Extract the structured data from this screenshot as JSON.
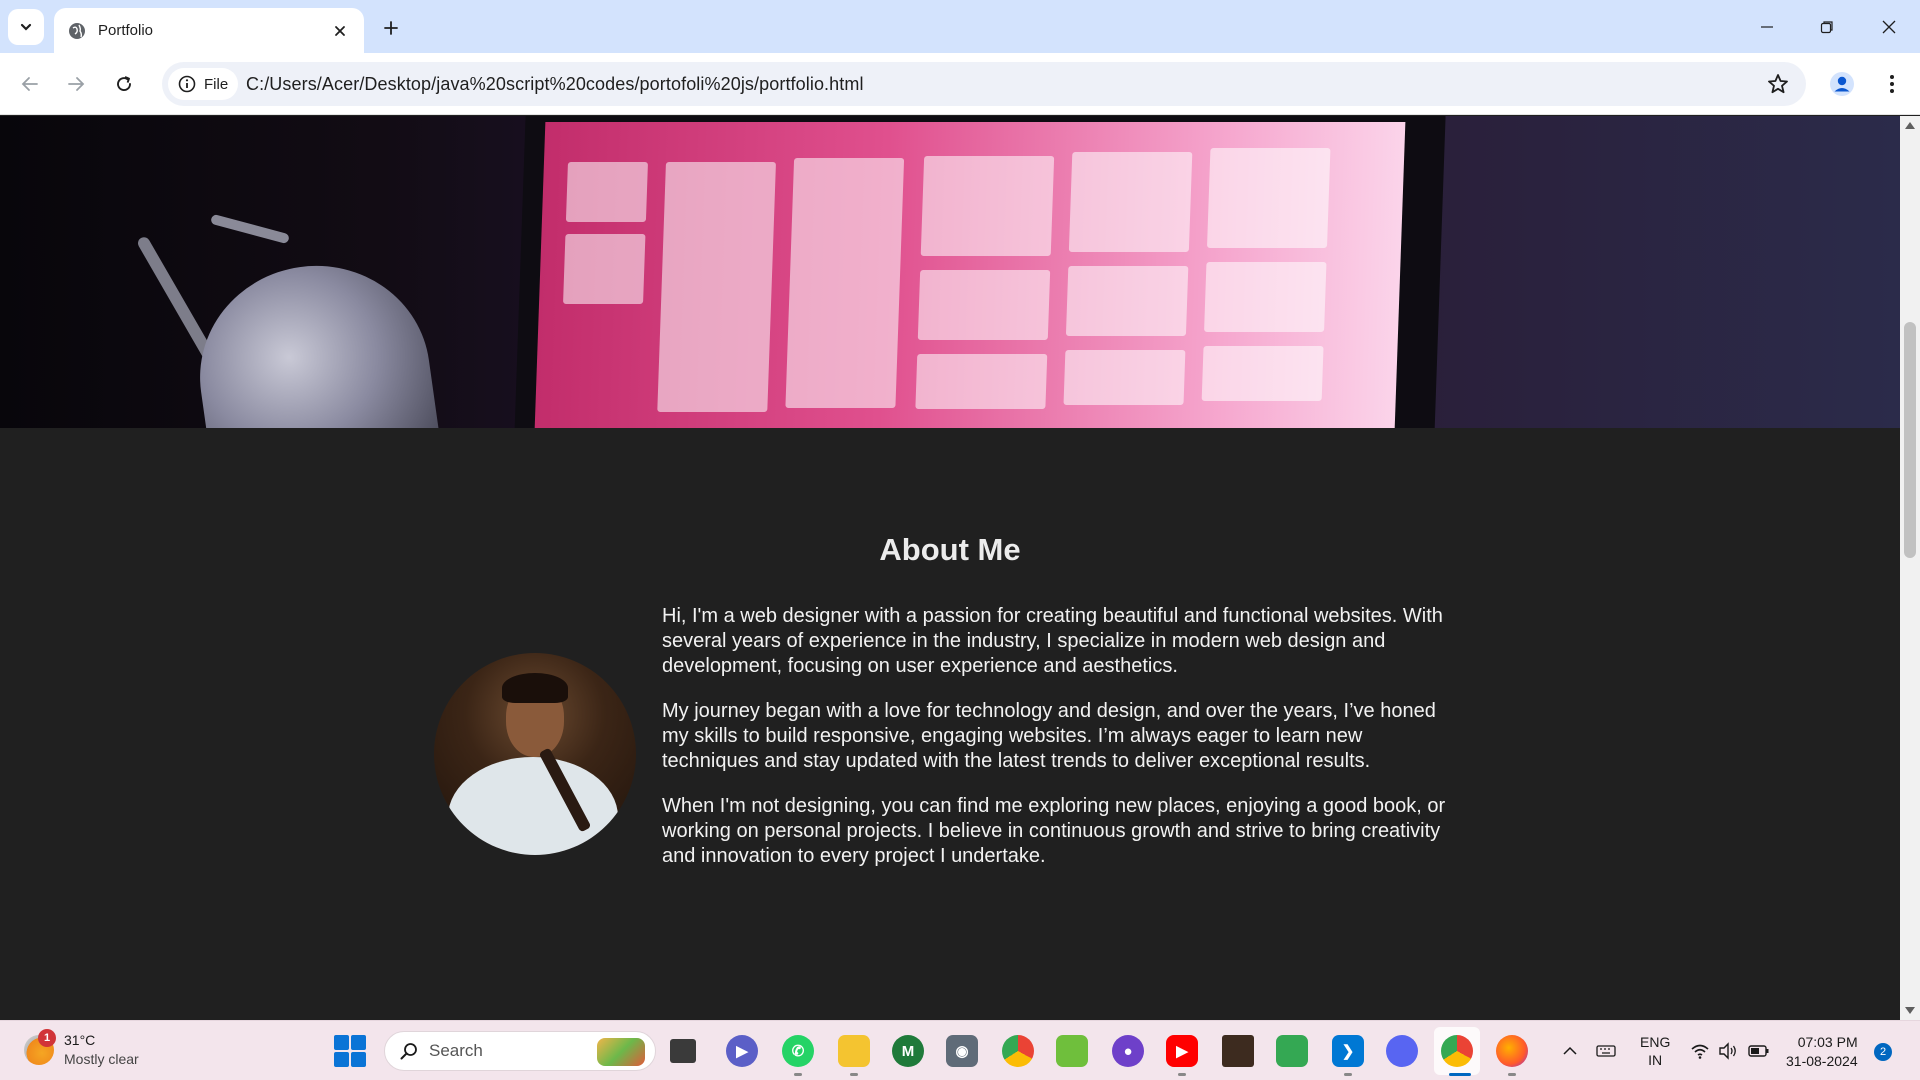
{
  "browser": {
    "tab_title": "Portfolio",
    "site_chip_label": "File",
    "url": "C:/Users/Acer/Desktop/java%20script%20codes/portofoli%20js/portfolio.html"
  },
  "page": {
    "about_title": "About Me",
    "paragraphs": [
      "Hi, I'm a web designer with a passion for creating beautiful and functional websites. With several years of experience in the industry, I specialize in modern web design and development, focusing on user experience and aesthetics.",
      "My journey began with a love for technology and design, and over the years, I’ve honed my skills to build responsive, engaging websites. I’m always eager to learn new techniques and stay updated with the latest trends to deliver exceptional results.",
      "When I'm not designing, you can find me exploring new places, enjoying a good book, or working on personal projects. I believe in continuous growth and strive to bring creativity and innovation to every project I undertake."
    ]
  },
  "taskbar": {
    "weather_temp": "31°C",
    "weather_desc": "Mostly clear",
    "weather_badge": "1",
    "search_placeholder": "Search",
    "language_top": "ENG",
    "language_bottom": "IN",
    "time": "07:03 PM",
    "date": "31-08-2024",
    "notification_count": "2",
    "apps": [
      "task-view",
      "teams-meet",
      "whatsapp",
      "file-explorer",
      "mongodb",
      "camera",
      "chrome",
      "game",
      "github",
      "youtube",
      "minecraft",
      "chat",
      "vscode",
      "discord",
      "chrome-active",
      "firefox"
    ]
  },
  "colors": {
    "tabstrip": "#d3e3fd",
    "page_background": "#202020",
    "accent": "#0a74d6"
  }
}
